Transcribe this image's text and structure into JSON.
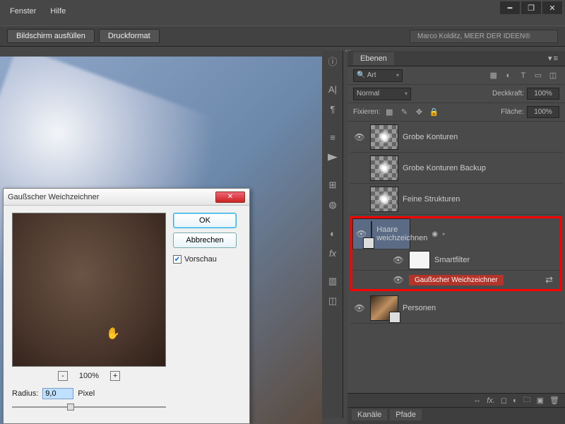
{
  "menubar": {
    "fenster": "Fenster",
    "hilfe": "Hilfe"
  },
  "toolbar": {
    "fullscreen": "Bildschirm ausfüllen",
    "printformat": "Druckformat",
    "watermark": "Marco Kolditz, MEER DER IDEEN®"
  },
  "panel": {
    "title": "Ebenen",
    "search_placeholder": "Art",
    "blend": "Normal",
    "opacity_label": "Deckkraft:",
    "opacity": "100%",
    "lock_label": "Fixieren:",
    "fill_label": "Fläche:",
    "fill": "100%"
  },
  "layers": [
    {
      "name": "Grobe Konturen"
    },
    {
      "name": "Grobe Konturen Backup"
    },
    {
      "name": "Feine Strukturen"
    },
    {
      "name": "Haare weichzeichnen"
    },
    {
      "name": "Smartfilter"
    },
    {
      "effect": "Gaußscher Weichzeichner"
    },
    {
      "name": "Personen"
    }
  ],
  "bottom_tabs": {
    "kanale": "Kanäle",
    "pfade": "Pfade"
  },
  "dialog": {
    "title": "Gaußscher Weichzeichner",
    "ok": "OK",
    "cancel": "Abbrechen",
    "preview": "Vorschau",
    "zoom": "100%",
    "radius_label": "Radius:",
    "radius": "9,0",
    "radius_unit": "Pixel"
  }
}
